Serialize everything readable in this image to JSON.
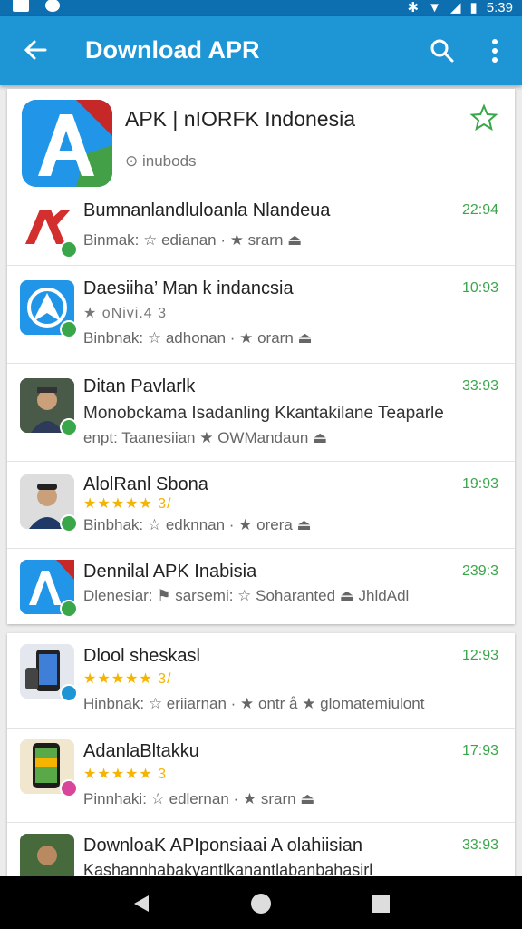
{
  "app_bar": {
    "title": "Download APR",
    "color": "#1e95d4"
  },
  "status_bar": {
    "time": "5:39"
  },
  "hero": {
    "name": "APK | nIORFK Indonesia",
    "meta": "⊙ inubods",
    "icon": "apk-logo"
  },
  "rows": [
    {
      "title": "Bumnanlandluloanla Nlandeua",
      "time": "22:94",
      "sub": "Binmak: ☆ edianan · ★ srarn ⏏",
      "icon": "apk-red-logo"
    },
    {
      "title": "Daesiiha’ Man k indancsia",
      "time": "10:93",
      "rating": "★ oNivi.4 3",
      "sub": "Binbnak: ☆ adhonan · ★ orarn ⏏",
      "icon": "compass-app-logo"
    },
    {
      "title": "Ditan Pavlarlk",
      "time": "33:93",
      "line2": "Monobckama Isadanling Kkantakilane Teaparle",
      "sub": "enpt: Taanesiian        ★ OWMandaun ⏏",
      "icon": "person-photo"
    },
    {
      "title": "AlolRanl Sbona",
      "time": "19:93",
      "rating": "★★★★★ 3/",
      "sub": "Binbhak: ☆ edknnan · ★ orera ⏏",
      "icon": "person-photo"
    },
    {
      "title": "Dennilal APK Inabisia",
      "time": "239:3",
      "sub": "Dlenesiar: ⚑ sarsemi: ☆ Soharanted   ⏏ JhldAdl",
      "icon": "apk-logo"
    }
  ],
  "rows2": [
    {
      "title": "Dlool sheskasl",
      "time": "12:93",
      "rating": "★★★★★ 3/",
      "sub": "Hinbnak: ☆ eriiarnan · ★ ontr å  ★ glomatemiulont",
      "icon": "phone-app-icon"
    },
    {
      "title": "AdanlaBltakku",
      "time": "17:93",
      "rating": "★★★★★ 3",
      "sub": "Pinnhaki: ☆ edlernan · ★ srarn ⏏",
      "icon": "phone-app-icon"
    },
    {
      "title": "DownloaK APIponsiaai A olahiisian",
      "time": "33:93",
      "line2": "Kashannhabakyantlkanantlabanbahasirl",
      "icon": "person-photo"
    }
  ],
  "colors": {
    "accent_green": "#3aa64a",
    "star_yellow": "#f4b400"
  }
}
